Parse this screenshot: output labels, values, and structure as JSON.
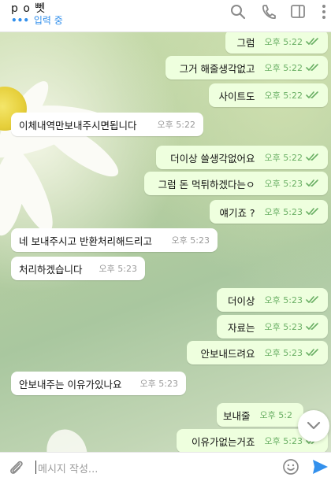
{
  "header": {
    "title": "p o 뻿",
    "status": "입력 중",
    "icons": [
      "search-icon",
      "phone-icon",
      "sidebar-icon",
      "more-icon"
    ]
  },
  "messages": [
    {
      "dir": "out",
      "text": "그럼",
      "time": "오후 5:22"
    },
    {
      "dir": "out",
      "text": "그거 해줄생각없고",
      "time": "오후 5:22"
    },
    {
      "dir": "out",
      "text": "사이트도",
      "time": "오후 5:22"
    },
    {
      "dir": "in",
      "text": "이체내역만보내주시면됩니다",
      "time": "오후 5:22"
    },
    {
      "dir": "out",
      "text": "더이상 쓸생각없어요",
      "time": "오후 5:22"
    },
    {
      "dir": "out",
      "text": "그럼 돈 먹튀하겠다는ㅇ",
      "time": "오후 5:23"
    },
    {
      "dir": "out",
      "text": "얘기죠 ?",
      "time": "오후 5:23"
    },
    {
      "dir": "in",
      "text": "네 보내주시고 반환처리해드리고",
      "time": "오후 5:23"
    },
    {
      "dir": "in",
      "text": "처리하겠습니다",
      "time": "오후 5:23"
    },
    {
      "dir": "out",
      "text": "더이상",
      "time": "오후 5:23"
    },
    {
      "dir": "out",
      "text": "자료는",
      "time": "오후 5:23"
    },
    {
      "dir": "out",
      "text": "안보내드려요",
      "time": "오후 5:23"
    },
    {
      "dir": "in",
      "text": "안보내주는 이유가있나요",
      "time": "오후 5:23"
    },
    {
      "dir": "out",
      "text": "보내줄",
      "time": "오후 5:2"
    },
    {
      "dir": "out",
      "text": "이유가없는거죠",
      "time": "오후 5:23"
    }
  ],
  "composer": {
    "placeholder": "메시지 작성..."
  },
  "colors": {
    "accent": "#3390ec",
    "outgoing_bubble": "#eeffde",
    "check": "#6aaf64"
  }
}
